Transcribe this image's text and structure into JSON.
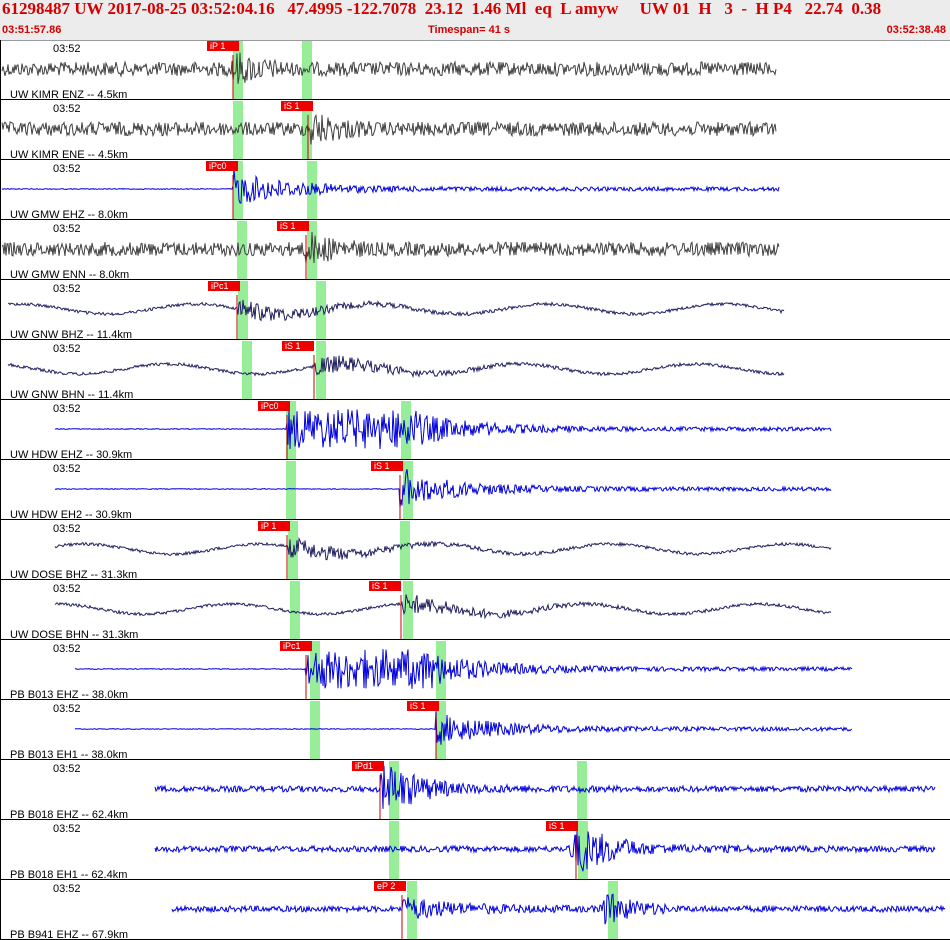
{
  "header": {
    "title": "61298487 UW 2017-08-25 03:52:04.16   47.4995 -122.7078  23.12  1.46 Ml  eq  L amyw     UW 01  H   3  -  H P4   22.74  0.38",
    "start_time": "03:51:57.86",
    "timespan": "Timespan=  41 s",
    "end_time": "03:52:38.48"
  },
  "colors": {
    "pick_flag": "#ee0000",
    "highlight": "#98ee98",
    "trace_gray": "#404040",
    "trace_blue": "#0000dd",
    "trace_navy": "#202060"
  },
  "traces": [
    {
      "label": "UW KIMR ENZ -- 4.5km",
      "time": "03:52",
      "pick": "iP 1",
      "color": "gray",
      "kind": "hf"
    },
    {
      "label": "UW KIMR ENE -- 4.5km",
      "time": "03:52",
      "pick": "iS 1",
      "color": "gray",
      "kind": "hf"
    },
    {
      "label": "UW GMW EHZ -- 8.0km",
      "time": "03:52",
      "pick": "iPc0",
      "color": "blue",
      "kind": "flatline"
    },
    {
      "label": "UW GMW ENN -- 8.0km",
      "time": "03:52",
      "pick": "iS 1",
      "color": "gray",
      "kind": "hf"
    },
    {
      "label": "UW GNW BHZ -- 11.4km",
      "time": "03:52",
      "pick": "iPc1",
      "color": "navy",
      "kind": "lp"
    },
    {
      "label": "UW GNW BHN -- 11.4km",
      "time": "03:52",
      "pick": "iS 1",
      "color": "navy",
      "kind": "lp"
    },
    {
      "label": "UW HDW EHZ -- 30.9km",
      "time": "03:52",
      "pick": "iPc0",
      "color": "blue",
      "kind": "flatline"
    },
    {
      "label": "UW HDW EH2 -- 30.9km",
      "time": "03:52",
      "pick": "iS 1",
      "color": "blue",
      "kind": "flatline"
    },
    {
      "label": "UW DOSE BHZ -- 31.3km",
      "time": "03:52",
      "pick": "iP 1",
      "color": "navy",
      "kind": "lp"
    },
    {
      "label": "UW DOSE BHN -- 31.3km",
      "time": "03:52",
      "pick": "iS 1",
      "color": "navy",
      "kind": "lp"
    },
    {
      "label": "PB B013 EHZ -- 38.0km",
      "time": "03:52",
      "pick": "iPc1",
      "color": "blue",
      "kind": "flatline"
    },
    {
      "label": "PB B013 EH1 -- 38.0km",
      "time": "03:52",
      "pick": "iS 1",
      "color": "blue",
      "kind": "flatline"
    },
    {
      "label": "PB B018 EHZ -- 62.4km",
      "time": "03:52",
      "pick": "iPd1",
      "color": "blue",
      "kind": "noisy"
    },
    {
      "label": "PB B018 EH1 -- 62.4km",
      "time": "03:52",
      "pick": "iS 1",
      "color": "blue",
      "kind": "noisy"
    },
    {
      "label": "PB B941 EHZ -- 67.9km",
      "time": "03:52",
      "pick": "eP 2",
      "color": "blue",
      "kind": "noisy"
    }
  ]
}
